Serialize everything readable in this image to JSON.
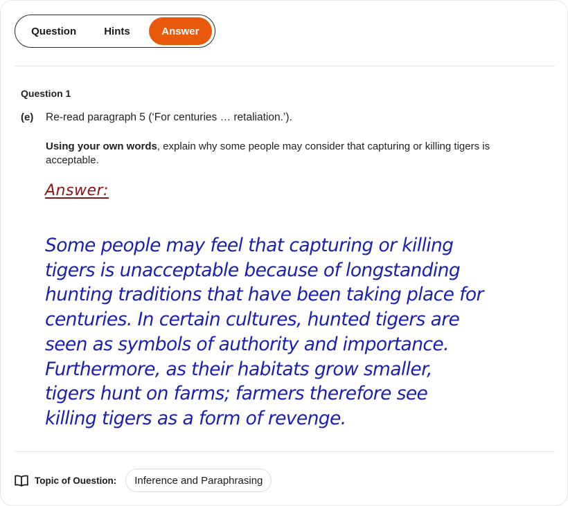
{
  "tabs": {
    "question": "Question",
    "hints": "Hints",
    "answer": "Answer",
    "active": "answer",
    "accent_color": "#e8590c"
  },
  "question": {
    "label": "Question 1",
    "part": "(e)",
    "prompt": "Re-read paragraph 5 (‘For centuries … retaliation.’).",
    "instruction_bold": "Using your own words",
    "instruction_rest": ", explain why some people may consider that capturing or killing tigers is acceptable."
  },
  "answer": {
    "heading": "Answer:",
    "heading_color": "#8b1414",
    "text_color": "#1b1fb0",
    "lines": [
      "Some people may feel that capturing or killing",
      "tigers is unacceptable because of longstanding",
      "hunting traditions that have been taking place for",
      "centuries. In certain cultures, hunted tigers are",
      "seen as symbols of authority and importance.",
      "Furthermore, as their habitats grow smaller,",
      "tigers hunt on farms; farmers therefore see",
      "killing tigers as a form of revenge."
    ]
  },
  "topic": {
    "icon": "book-icon",
    "label": "Topic of Ouestion:",
    "value": "Inference and Paraphrasing"
  }
}
